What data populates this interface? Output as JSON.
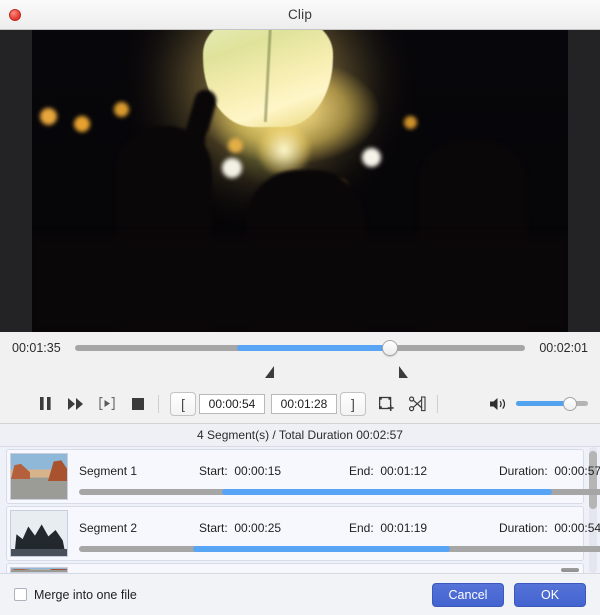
{
  "window": {
    "title": "Clip",
    "close_icon": "close-button"
  },
  "preview": {
    "scene_description": "night sky lantern release"
  },
  "timeline": {
    "current_time": "00:01:35",
    "total_time": "00:02:01",
    "selection_start_pct": 36,
    "selection_end_pct": 70,
    "playhead_pct": 70,
    "start_marker_pct": 36,
    "end_marker_pct": 70
  },
  "controls": {
    "pause_icon": "pause-icon",
    "forward_icon": "fast-forward-icon",
    "frame_step_icon": "frame-step-icon",
    "stop_icon": "stop-icon",
    "start_bracket": "[",
    "end_bracket": "]",
    "start_time_value": "00:00:54",
    "end_time_value": "00:01:28",
    "add_segment_icon": "add-segment-icon",
    "split_icon": "split-icon",
    "volume_icon": "volume-icon",
    "volume_pct": 75
  },
  "summary": {
    "text": "4 Segment(s) / Total Duration 00:02:57"
  },
  "segments": {
    "labels": {
      "start": "Start:",
      "end": "End:",
      "duration": "Duration:",
      "delete_icon": "close-icon",
      "move_up_icon": "chevron-up-icon",
      "move_down_icon": "chevron-down-icon"
    },
    "rows": [
      {
        "name": "Segment 1",
        "start": "00:00:15",
        "end": "00:01:12",
        "duration": "00:00:57",
        "bar_start_pct": 25,
        "bar_end_pct": 83,
        "thumb": "desert-road"
      },
      {
        "name": "Segment 2",
        "start": "00:00:25",
        "end": "00:01:19",
        "duration": "00:00:54",
        "bar_start_pct": 20,
        "bar_end_pct": 65,
        "thumb": "dark-cliff"
      }
    ]
  },
  "footer": {
    "merge_label": "Merge into one file",
    "merge_checked": false,
    "cancel_label": "Cancel",
    "ok_label": "OK"
  },
  "colors": {
    "accent_blue": "#59a5f5",
    "button_blue": "#4363cf",
    "track_gray": "#a6a6a6"
  }
}
